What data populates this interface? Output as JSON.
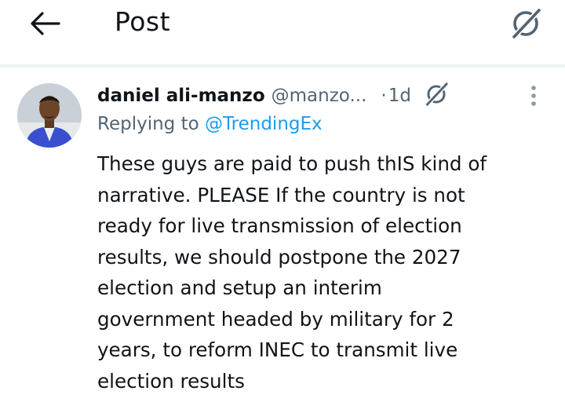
{
  "header": {
    "title": "Post"
  },
  "post": {
    "author": {
      "display_name": "daniel ali-manzo",
      "handle": "@manzo...",
      "time": "1d"
    },
    "separator": "·",
    "replying_label": "Replying to",
    "reply_to_handle": "@TrendingEx",
    "text": "These guys are paid to push thIS kind of\nnarrative. PLEASE If the country is not\nready for live transmission of election\nresults, we should postpone the 2027\nelection and setup an interim\ngovernment headed by military for 2\nyears, to reform INEC to transmit live\nelection results"
  },
  "icons": {
    "back": "arrow-left-icon",
    "grok": "grok-icon",
    "more": "more-vertical-icon"
  },
  "colors": {
    "text": "#0f1419",
    "secondary": "#536471",
    "accent": "#1d9bf0",
    "divider": "#eff3f4"
  }
}
